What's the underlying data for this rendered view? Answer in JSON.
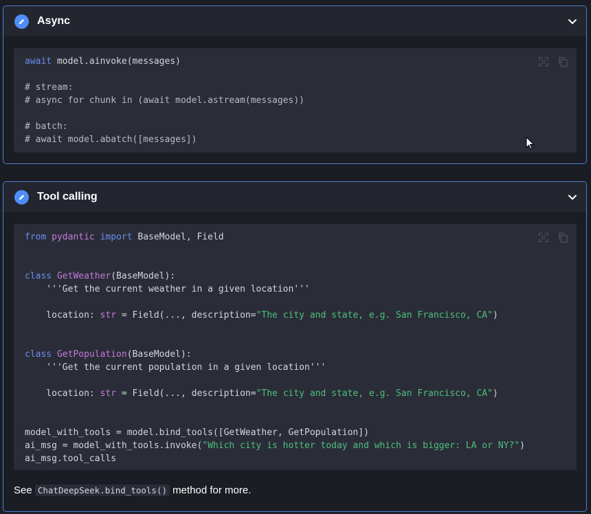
{
  "async_section": {
    "title": "Async",
    "code": [
      [
        {
          "t": "await",
          "c": "kw"
        },
        {
          "t": " model.ainvoke(messages)",
          "c": ""
        }
      ],
      [],
      [
        {
          "t": "# stream:",
          "c": "cm"
        }
      ],
      [
        {
          "t": "# async for chunk in (await model.astream(messages))",
          "c": "cm"
        }
      ],
      [],
      [
        {
          "t": "# batch:",
          "c": "cm"
        }
      ],
      [
        {
          "t": "# await model.abatch([messages])",
          "c": "cm"
        }
      ]
    ]
  },
  "tool_section": {
    "title": "Tool calling",
    "code": [
      [
        {
          "t": "from",
          "c": "kw"
        },
        {
          "t": " ",
          "c": ""
        },
        {
          "t": "pydantic",
          "c": "cls"
        },
        {
          "t": " ",
          "c": ""
        },
        {
          "t": "import",
          "c": "kw"
        },
        {
          "t": " BaseModel, Field",
          "c": ""
        }
      ],
      [],
      [],
      [
        {
          "t": "class",
          "c": "kw"
        },
        {
          "t": " ",
          "c": ""
        },
        {
          "t": "GetWeather",
          "c": "cls"
        },
        {
          "t": "(BaseModel):",
          "c": ""
        }
      ],
      [
        {
          "t": "    '''Get the current weather in a given location'''",
          "c": ""
        }
      ],
      [],
      [
        {
          "t": "    location: ",
          "c": ""
        },
        {
          "t": "str",
          "c": "cls"
        },
        {
          "t": " = Field(..., description=",
          "c": ""
        },
        {
          "t": "\"The city and state, e.g. San Francisco, CA\"",
          "c": "str"
        },
        {
          "t": ")",
          "c": ""
        }
      ],
      [],
      [],
      [
        {
          "t": "class",
          "c": "kw"
        },
        {
          "t": " ",
          "c": ""
        },
        {
          "t": "GetPopulation",
          "c": "cls"
        },
        {
          "t": "(BaseModel):",
          "c": ""
        }
      ],
      [
        {
          "t": "    '''Get the current population in a given location'''",
          "c": ""
        }
      ],
      [],
      [
        {
          "t": "    location: ",
          "c": ""
        },
        {
          "t": "str",
          "c": "cls"
        },
        {
          "t": " = Field(..., description=",
          "c": ""
        },
        {
          "t": "\"The city and state, e.g. San Francisco, CA\"",
          "c": "str"
        },
        {
          "t": ")",
          "c": ""
        }
      ],
      [],
      [],
      [
        {
          "t": "model_with_tools = model.bind_tools([GetWeather, GetPopulation])",
          "c": ""
        }
      ],
      [
        {
          "t": "ai_msg = model_with_tools.invoke(",
          "c": ""
        },
        {
          "t": "\"Which city is hotter today and which is bigger: LA or NY?\"",
          "c": "str"
        },
        {
          "t": ")",
          "c": ""
        }
      ],
      [
        {
          "t": "ai_msg.tool_calls",
          "c": ""
        }
      ]
    ],
    "footer": {
      "prefix": "See ",
      "code": "ChatDeepSeek.bind_tools()",
      "suffix": " method for more."
    }
  },
  "icons": {
    "section_icon": "pencil-icon",
    "collapse": "chevron-down-icon",
    "expand": "expand-icon",
    "copy": "copy-icon"
  },
  "colors": {
    "accent": "#4f8ef7",
    "border": "#4f7fd6",
    "keyword": "#6c8cf0",
    "class": "#c678dd",
    "string": "#4fbf7e"
  }
}
